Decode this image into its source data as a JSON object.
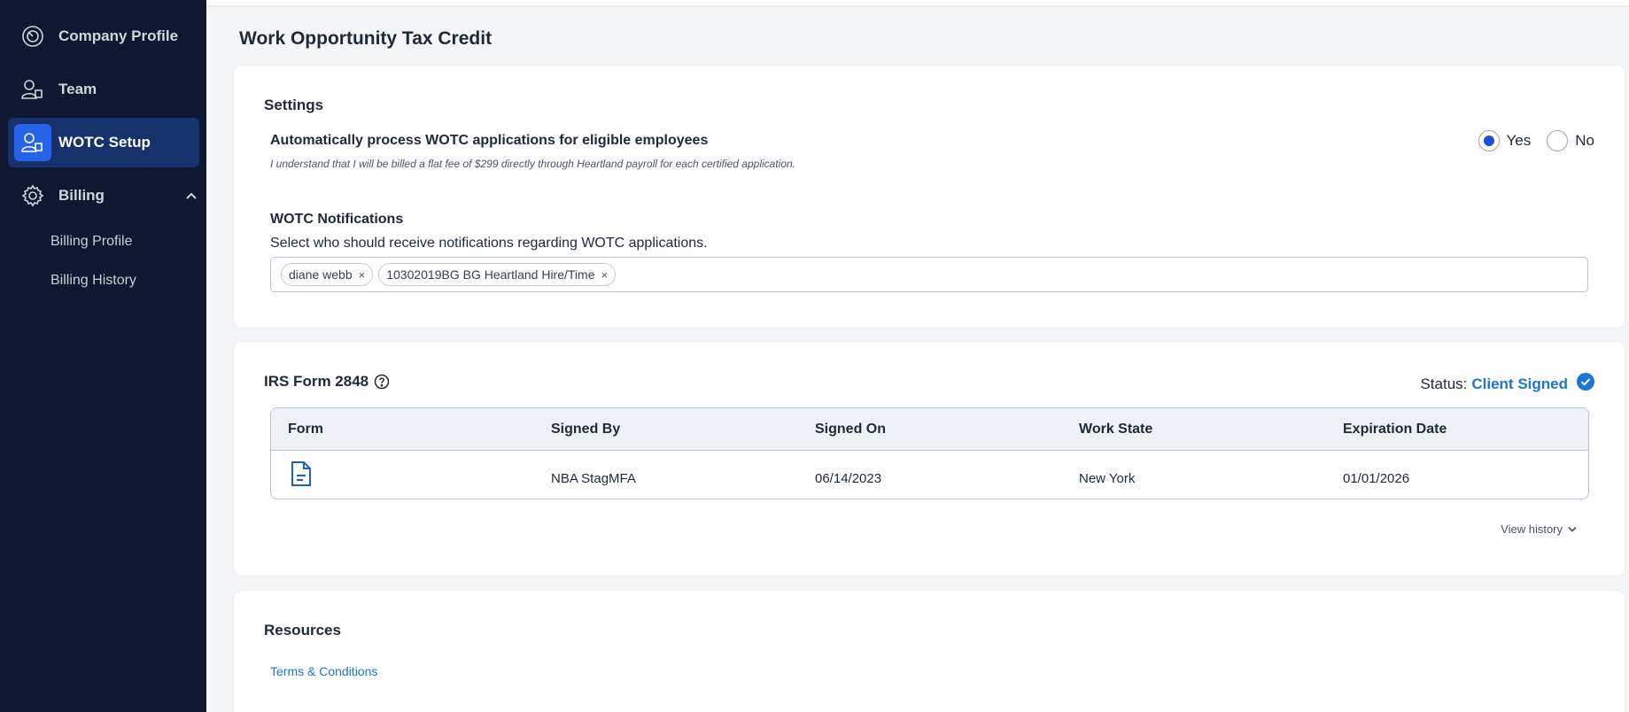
{
  "sidebar": {
    "items": [
      {
        "label": "Company Profile",
        "icon": "speedometer-icon"
      },
      {
        "label": "Team",
        "icon": "users-icon"
      },
      {
        "label": "WOTC Setup",
        "icon": "user-setup-icon",
        "active": true
      },
      {
        "label": "Billing",
        "icon": "gear-icon",
        "expanded": true
      }
    ],
    "billing_sub": [
      "Billing Profile",
      "Billing History"
    ]
  },
  "page": {
    "title": "Work Opportunity Tax Credit"
  },
  "settings": {
    "heading": "Settings",
    "auto_process": {
      "title": "Automatically process WOTC applications for eligible employees",
      "disclaimer": "I understand that I will be billed a flat fee of $299 directly through Heartland payroll for each certified application.",
      "options": [
        "Yes",
        "No"
      ],
      "selected": "Yes"
    },
    "notifications": {
      "title": "WOTC Notifications",
      "description": "Select who should receive notifications regarding WOTC applications.",
      "recipients": [
        "diane webb",
        "10302019BG BG Heartland Hire/Time"
      ],
      "remove_glyph": "×"
    }
  },
  "irs_form": {
    "heading": "IRS Form 2848",
    "status_label": "Status:",
    "status_value": "Client Signed",
    "columns": [
      "Form",
      "Signed By",
      "Signed On",
      "Work State",
      "Expiration Date"
    ],
    "row": {
      "signed_by": "NBA StagMFA",
      "signed_on": "06/14/2023",
      "work_state": "New York",
      "expiration": "01/01/2026"
    },
    "view_history": "View history"
  },
  "resources": {
    "heading": "Resources",
    "link": "Terms & Conditions"
  },
  "colors": {
    "sidebar_bg": "#0f1830",
    "active_bg": "#16316b",
    "accent": "#1d74d8",
    "icon_active_bg": "#2563eb"
  }
}
